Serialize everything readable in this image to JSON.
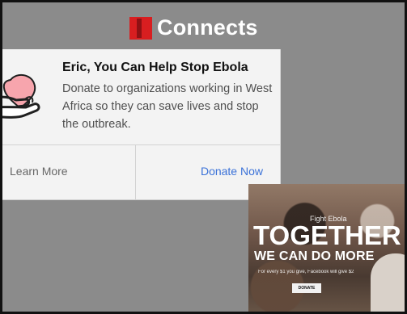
{
  "brand": {
    "name": "Connects",
    "logo_color": "#d81e20"
  },
  "card": {
    "title": "Eric, You Can Help Stop Ebola",
    "description": "Donate to organizations working in West Africa so they can save lives and stop the outbreak.",
    "learn_more": "Learn More",
    "donate_now": "Donate Now",
    "link_color": "#3b72d8",
    "icon": "heart-hand-icon"
  },
  "promo": {
    "label": "Fight Ebola",
    "headline": "TOGETHER",
    "subheadline": "WE CAN DO MORE",
    "note": "For every $1 you give, Facebook will give $2",
    "button": "DONATE"
  }
}
